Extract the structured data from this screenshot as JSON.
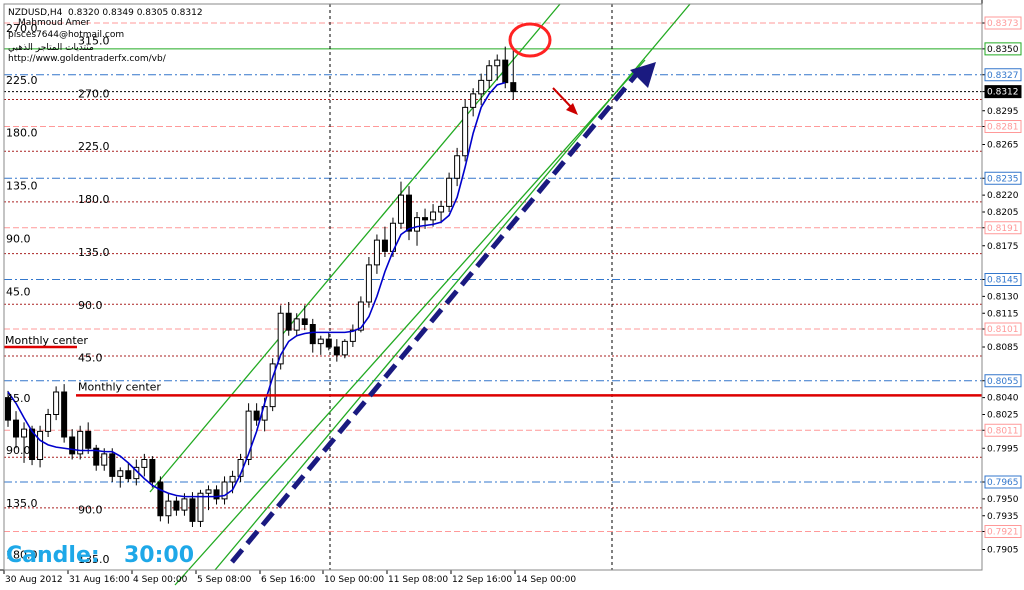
{
  "header": {
    "symbol": "NZDUSD,H4",
    "ohlc": "0.8320 0.8349 0.8305 0.8312",
    "author": "Mahmoud Amer",
    "email": "pisces7644@hotmail.com",
    "forum": "منتديات المتاجر الذهبي",
    "url": "http://www.goldentraderfx.com/vb/"
  },
  "timer": {
    "label": "Candle:",
    "value": "30:00"
  },
  "colors": {
    "candle": "#000000",
    "ma": "#0000cc",
    "channel": "#22aa22",
    "trend_arrow": "#1a1a80",
    "red_arrow": "#cc0000",
    "monthly_center": "#dd0000",
    "highlight_circle": "#ff2222",
    "pink_level": "#ff9999",
    "blue_level": "#3377cc",
    "red_level": "#aa2222"
  },
  "chart_data": {
    "type": "candlestick",
    "title": "NZDUSD,H4",
    "ylim": [
      0.7893,
      0.8381
    ],
    "yticks": [
      "0.8373",
      "0.8350",
      "0.8327",
      "0.8312",
      "0.8295",
      "0.8281",
      "0.8265",
      "0.8235",
      "0.8220",
      "0.8205",
      "0.8191",
      "0.8175",
      "0.8145",
      "0.8130",
      "0.8115",
      "0.8101",
      "0.8085",
      "0.8055",
      "0.8040",
      "0.8025",
      "0.8011",
      "0.7995",
      "0.7965",
      "0.7950",
      "0.7935",
      "0.7921",
      "0.7905"
    ],
    "current_price": "0.8312",
    "x_labels": [
      "30 Aug 2012",
      "31 Aug 16:00",
      "4 Sep 00:00",
      "5 Sep 08:00",
      "6 Sep 16:00",
      "10 Sep 00:00",
      "11 Sep 08:00",
      "12 Sep 16:00",
      "14 Sep 00:00"
    ],
    "levels": [
      {
        "price": 0.8373,
        "style": "pink",
        "boxed": true
      },
      {
        "price": 0.835,
        "style": "green",
        "boxed": true
      },
      {
        "price": 0.8327,
        "style": "blue",
        "boxed": true
      },
      {
        "price": 0.8312,
        "style": "black",
        "boxed": true
      },
      {
        "price": 0.8305,
        "style": "red",
        "boxed": false
      },
      {
        "price": 0.8281,
        "style": "pink",
        "boxed": true
      },
      {
        "price": 0.8259,
        "style": "red",
        "boxed": false
      },
      {
        "price": 0.8235,
        "style": "blue",
        "boxed": true
      },
      {
        "price": 0.8214,
        "style": "red",
        "boxed": false
      },
      {
        "price": 0.8191,
        "style": "pink",
        "boxed": true
      },
      {
        "price": 0.8168,
        "style": "red",
        "boxed": false
      },
      {
        "price": 0.8145,
        "style": "blue",
        "boxed": true
      },
      {
        "price": 0.8123,
        "style": "red",
        "boxed": false
      },
      {
        "price": 0.8101,
        "style": "pink",
        "boxed": true
      },
      {
        "price": 0.8077,
        "style": "red",
        "boxed": false
      },
      {
        "price": 0.8055,
        "style": "blue",
        "boxed": true
      },
      {
        "price": 0.8011,
        "style": "pink",
        "boxed": true
      },
      {
        "price": 0.7987,
        "style": "red",
        "boxed": false
      },
      {
        "price": 0.7965,
        "style": "blue",
        "boxed": true
      },
      {
        "price": 0.7942,
        "style": "red",
        "boxed": false
      },
      {
        "price": 0.7921,
        "style": "pink",
        "boxed": true
      }
    ],
    "monthly_center": {
      "price": 0.8042,
      "label": "Monthly center"
    },
    "monthly_center_left": {
      "price": 0.8085,
      "label": "Monthly center"
    },
    "gann_labels_left": [
      {
        "text": "270.0",
        "price": 0.8365
      },
      {
        "text": "225.0",
        "price": 0.8319
      },
      {
        "text": "180.0",
        "price": 0.8272
      },
      {
        "text": "135.0",
        "price": 0.8225
      },
      {
        "text": "90.0",
        "price": 0.8178
      },
      {
        "text": "45.0",
        "price": 0.8131
      },
      {
        "text": "45.0",
        "price": 0.8036
      },
      {
        "text": "90.0",
        "price": 0.799
      },
      {
        "text": "135.0",
        "price": 0.7943
      },
      {
        "text": "180.0",
        "price": 0.7897
      }
    ],
    "gann_labels_mid": [
      {
        "text": "315.0",
        "price": 0.8354
      },
      {
        "text": "270.0",
        "price": 0.8307
      },
      {
        "text": "225.0",
        "price": 0.826
      },
      {
        "text": "180.0",
        "price": 0.8213
      },
      {
        "text": "135.0",
        "price": 0.8166
      },
      {
        "text": "90.0",
        "price": 0.8119
      },
      {
        "text": "45.0",
        "price": 0.8072
      },
      {
        "text": "90.0",
        "price": 0.7937
      },
      {
        "text": "135.0",
        "price": 0.7893
      }
    ],
    "candles": [
      [
        0.804,
        0.8046,
        0.8014,
        0.802
      ],
      [
        0.802,
        0.8028,
        0.7995,
        0.8005
      ],
      [
        0.8005,
        0.8018,
        0.7982,
        0.8012
      ],
      [
        0.8012,
        0.8015,
        0.798,
        0.7985
      ],
      [
        0.7985,
        0.8015,
        0.7978,
        0.801
      ],
      [
        0.801,
        0.803,
        0.8005,
        0.8025
      ],
      [
        0.8025,
        0.805,
        0.802,
        0.8045
      ],
      [
        0.8045,
        0.8052,
        0.8,
        0.8005
      ],
      [
        0.8005,
        0.8012,
        0.7985,
        0.799
      ],
      [
        0.799,
        0.8015,
        0.7985,
        0.801
      ],
      [
        0.801,
        0.8018,
        0.799,
        0.7995
      ],
      [
        0.7995,
        0.7998,
        0.7975,
        0.798
      ],
      [
        0.798,
        0.7995,
        0.7975,
        0.799
      ],
      [
        0.799,
        0.7995,
        0.7965,
        0.797
      ],
      [
        0.797,
        0.7978,
        0.796,
        0.7975
      ],
      [
        0.7975,
        0.7982,
        0.7965,
        0.7968
      ],
      [
        0.7968,
        0.7985,
        0.7962,
        0.7978
      ],
      [
        0.7978,
        0.799,
        0.797,
        0.7985
      ],
      [
        0.7985,
        0.7988,
        0.796,
        0.7965
      ],
      [
        0.7965,
        0.797,
        0.793,
        0.7935
      ],
      [
        0.7935,
        0.7955,
        0.7928,
        0.7948
      ],
      [
        0.7948,
        0.7952,
        0.7935,
        0.794
      ],
      [
        0.794,
        0.7955,
        0.7935,
        0.795
      ],
      [
        0.795,
        0.7956,
        0.7925,
        0.793
      ],
      [
        0.793,
        0.7958,
        0.7925,
        0.7955
      ],
      [
        0.7955,
        0.7962,
        0.794,
        0.7958
      ],
      [
        0.7958,
        0.7962,
        0.7945,
        0.795
      ],
      [
        0.795,
        0.797,
        0.7945,
        0.7965
      ],
      [
        0.7965,
        0.7975,
        0.7955,
        0.797
      ],
      [
        0.797,
        0.799,
        0.7965,
        0.7985
      ],
      [
        0.7985,
        0.8035,
        0.798,
        0.8028
      ],
      [
        0.8028,
        0.8035,
        0.8015,
        0.802
      ],
      [
        0.802,
        0.804,
        0.801,
        0.8032
      ],
      [
        0.8032,
        0.8075,
        0.8028,
        0.807
      ],
      [
        0.807,
        0.8122,
        0.8065,
        0.8115
      ],
      [
        0.8115,
        0.8125,
        0.8095,
        0.81
      ],
      [
        0.81,
        0.8115,
        0.8095,
        0.811
      ],
      [
        0.811,
        0.8122,
        0.81,
        0.8105
      ],
      [
        0.8105,
        0.811,
        0.808,
        0.8088
      ],
      [
        0.8088,
        0.8095,
        0.8078,
        0.8092
      ],
      [
        0.8092,
        0.8098,
        0.8082,
        0.8085
      ],
      [
        0.8085,
        0.8092,
        0.8072,
        0.8078
      ],
      [
        0.8078,
        0.8092,
        0.8075,
        0.809
      ],
      [
        0.809,
        0.8105,
        0.8085,
        0.81
      ],
      [
        0.81,
        0.813,
        0.8098,
        0.8125
      ],
      [
        0.8125,
        0.8165,
        0.812,
        0.8158
      ],
      [
        0.8158,
        0.8185,
        0.815,
        0.818
      ],
      [
        0.818,
        0.8192,
        0.8165,
        0.817
      ],
      [
        0.817,
        0.82,
        0.8165,
        0.8195
      ],
      [
        0.8195,
        0.8232,
        0.819,
        0.822
      ],
      [
        0.822,
        0.8228,
        0.818,
        0.8188
      ],
      [
        0.8188,
        0.8205,
        0.8175,
        0.82
      ],
      [
        0.82,
        0.8208,
        0.819,
        0.8198
      ],
      [
        0.8198,
        0.8212,
        0.8192,
        0.8205
      ],
      [
        0.8205,
        0.8215,
        0.8195,
        0.821
      ],
      [
        0.821,
        0.824,
        0.8205,
        0.8235
      ],
      [
        0.8235,
        0.8262,
        0.8228,
        0.8255
      ],
      [
        0.8255,
        0.8305,
        0.825,
        0.8298
      ],
      [
        0.8298,
        0.8315,
        0.829,
        0.831
      ],
      [
        0.831,
        0.8328,
        0.83,
        0.8322
      ],
      [
        0.8322,
        0.834,
        0.8315,
        0.8335
      ],
      [
        0.8335,
        0.8345,
        0.8322,
        0.834
      ],
      [
        0.834,
        0.8352,
        0.8315,
        0.832
      ],
      [
        0.832,
        0.8349,
        0.8305,
        0.8312
      ]
    ],
    "ma": [
      0.8045,
      0.8035,
      0.8022,
      0.801,
      0.8002,
      0.7998,
      0.7996,
      0.7995,
      0.7994,
      0.7993,
      0.7993,
      0.7993,
      0.7992,
      0.7992,
      0.7988,
      0.7982,
      0.7975,
      0.7968,
      0.7962,
      0.7958,
      0.7955,
      0.7953,
      0.7952,
      0.7952,
      0.7952,
      0.7952,
      0.7952,
      0.7953,
      0.7958,
      0.7972,
      0.799,
      0.801,
      0.8035,
      0.8058,
      0.8078,
      0.809,
      0.8095,
      0.8097,
      0.8098,
      0.8098,
      0.8098,
      0.8098,
      0.8098,
      0.8099,
      0.8102,
      0.8112,
      0.813,
      0.8152,
      0.817,
      0.8185,
      0.819,
      0.8192,
      0.8193,
      0.8194,
      0.8196,
      0.8202,
      0.8218,
      0.8245,
      0.8275,
      0.8298,
      0.831,
      0.8318,
      0.832
    ]
  }
}
